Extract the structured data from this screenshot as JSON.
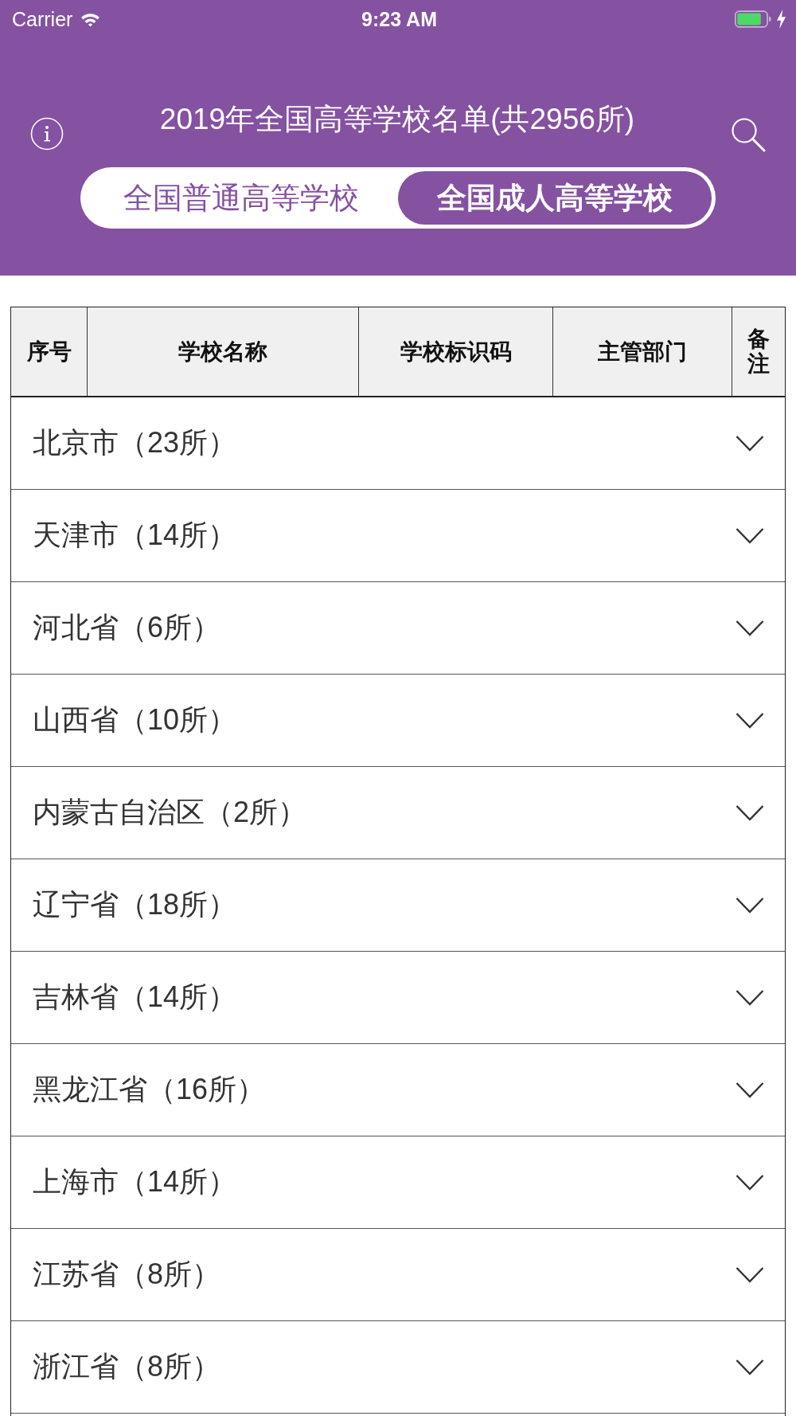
{
  "status_bar": {
    "carrier": "Carrier",
    "time": "9:23 AM"
  },
  "nav": {
    "title": "2019年全国高等学校名单(共2956所)",
    "segments": [
      {
        "label": "全国普通高等学校",
        "selected": false
      },
      {
        "label": "全国成人高等学校",
        "selected": true
      }
    ]
  },
  "table": {
    "columns": [
      "序号",
      "学校名称",
      "学校标识码",
      "主管部门",
      "备注"
    ],
    "groups": [
      {
        "label": "北京市（23所）",
        "expanded": false
      },
      {
        "label": "天津市（14所）",
        "expanded": false
      },
      {
        "label": "河北省（6所）",
        "expanded": false
      },
      {
        "label": "山西省（10所）",
        "expanded": false
      },
      {
        "label": "内蒙古自治区（2所）",
        "expanded": false
      },
      {
        "label": "辽宁省（18所）",
        "expanded": false
      },
      {
        "label": "吉林省（14所）",
        "expanded": false
      },
      {
        "label": "黑龙江省（16所）",
        "expanded": false
      },
      {
        "label": "上海市（14所）",
        "expanded": false
      },
      {
        "label": "江苏省（8所）",
        "expanded": false
      },
      {
        "label": "浙江省（8所）",
        "expanded": false
      }
    ]
  }
}
